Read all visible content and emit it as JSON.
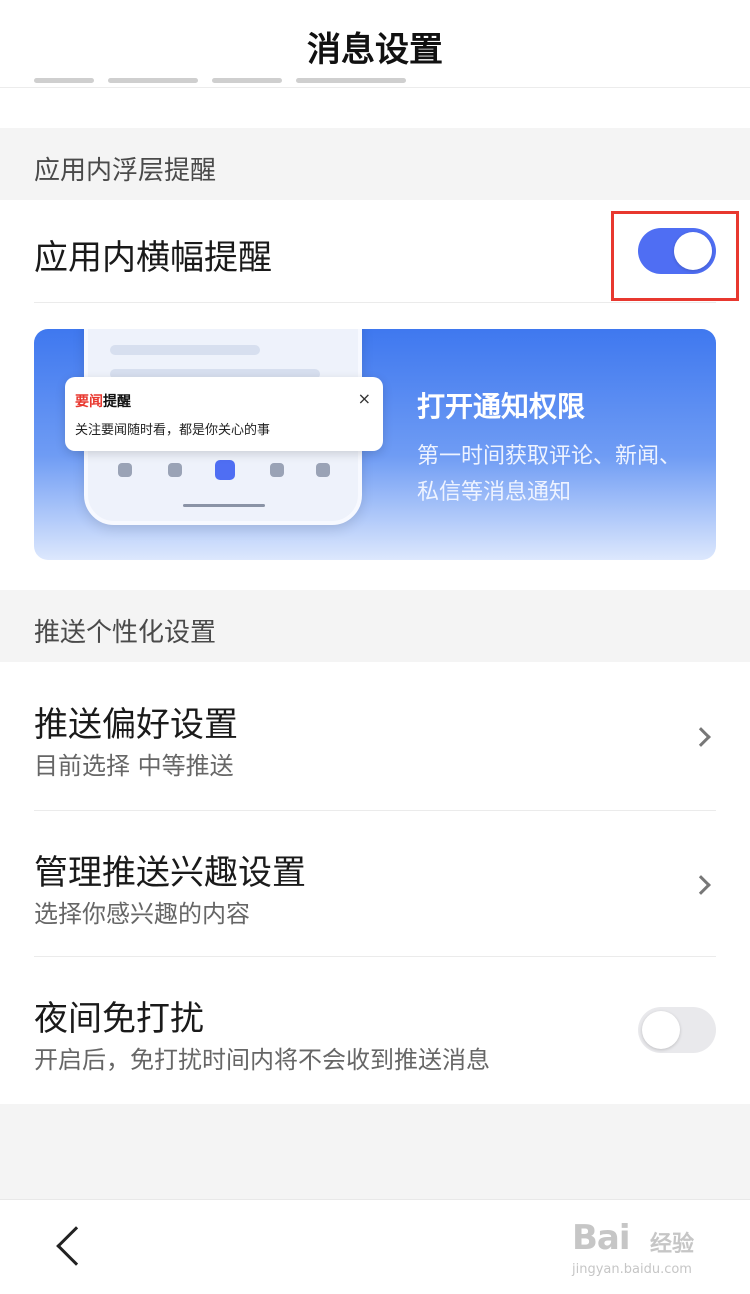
{
  "header": {
    "title": "消息设置"
  },
  "sections": {
    "floating": {
      "label": "应用内浮层提醒"
    },
    "personal": {
      "label": "推送个性化设置"
    }
  },
  "banner_setting": {
    "title": "应用内横幅提醒",
    "enabled": true
  },
  "promo": {
    "popup_title_red": "要闻",
    "popup_title_dark": "提醒",
    "popup_body": "关注要闻随时看，都是你关心的事",
    "popup_close": "×",
    "title": "打开通知权限",
    "desc_line1": "第一时间获取评论、新闻、",
    "desc_line2": "私信等消息通知"
  },
  "items": [
    {
      "title": "推送偏好设置",
      "subtitle": "目前选择 中等推送"
    },
    {
      "title": "管理推送兴趣设置",
      "subtitle": "选择你感兴趣的内容"
    },
    {
      "title": "夜间免打扰",
      "subtitle": "开启后，免打扰时间内将不会收到推送消息",
      "enabled": false
    }
  ],
  "watermark": {
    "logo": "Bai",
    "brand": "经验",
    "url": "jingyan.baidu.com"
  },
  "colors": {
    "accent": "#4f6ef3",
    "highlight_box": "#e8382f"
  }
}
